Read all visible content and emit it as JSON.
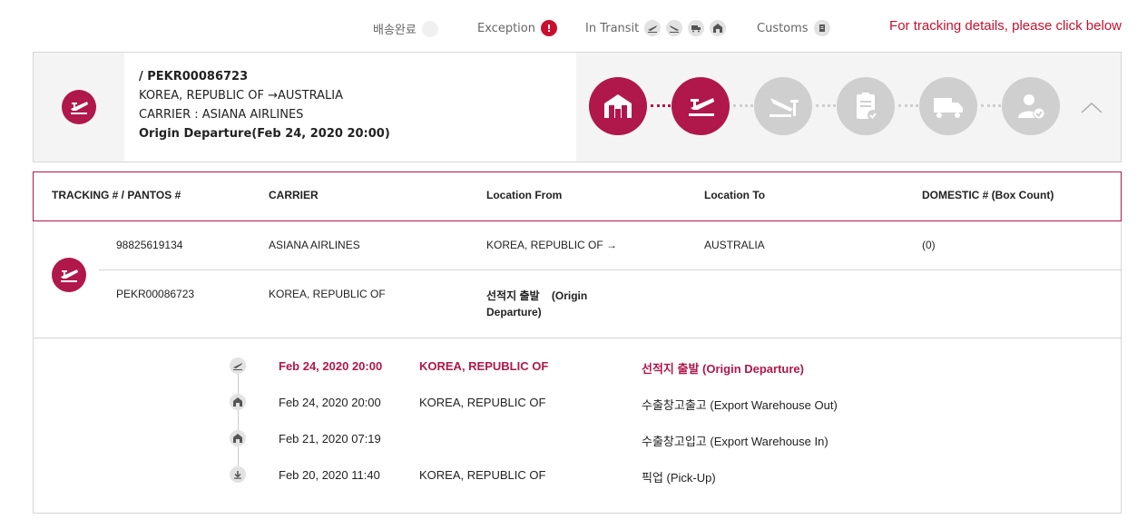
{
  "legend": {
    "delivered": "배송완료",
    "exception": "Exception",
    "exception_badge": "!",
    "in_transit": "In Transit",
    "customs": "Customs",
    "link": "For tracking details, please click below"
  },
  "summary": {
    "tracking": "/ PEKR00086723",
    "route": "KOREA, REPUBLIC OF →AUSTRALIA",
    "carrier": "CARRIER : ASIANA AIRLINES",
    "status": "Origin Departure(Feb 24, 2020 20:00)"
  },
  "steps": [
    {
      "name": "warehouse",
      "active": true
    },
    {
      "name": "departure",
      "active": true
    },
    {
      "name": "arrival",
      "active": false
    },
    {
      "name": "customs",
      "active": false
    },
    {
      "name": "delivery",
      "active": false
    },
    {
      "name": "received",
      "active": false
    }
  ],
  "table": {
    "headers": [
      "TRACKING # / PANTOS #",
      "CARRIER",
      "Location From",
      "Location To",
      "DOMESTIC # (Box Count)"
    ],
    "row1": {
      "tracking": "98825619134",
      "carrier": "ASIANA AIRLINES",
      "from": "KOREA, REPUBLIC OF →",
      "to": "AUSTRALIA",
      "domestic": "(0)"
    },
    "row2": {
      "pantos": "PEKR00086723",
      "location": "KOREA, REPUBLIC OF",
      "status_line1": "선적지 출발    (Origin",
      "status_line2": "Departure)"
    }
  },
  "timeline": [
    {
      "date": "Feb 24, 2020 20:00",
      "location": "KOREA, REPUBLIC OF",
      "event": "선적지 출발 (Origin Departure)",
      "icon": "plane-icon",
      "highlight": true
    },
    {
      "date": "Feb 24, 2020 20:00",
      "location": "KOREA, REPUBLIC OF",
      "event": "수출창고출고 (Export Warehouse Out)",
      "icon": "warehouse-icon",
      "highlight": false
    },
    {
      "date": "Feb 21, 2020 07:19",
      "location": "",
      "event": "수출창고입고 (Export Warehouse In)",
      "icon": "warehouse-icon",
      "highlight": false
    },
    {
      "date": "Feb 20, 2020 11:40",
      "location": "KOREA, REPUBLIC OF",
      "event": "픽업 (Pick-Up)",
      "icon": "pickup-icon",
      "highlight": false
    }
  ],
  "colors": {
    "accent": "#b0174b",
    "exception": "#c8102e",
    "inactive": "#cfcfcf"
  }
}
